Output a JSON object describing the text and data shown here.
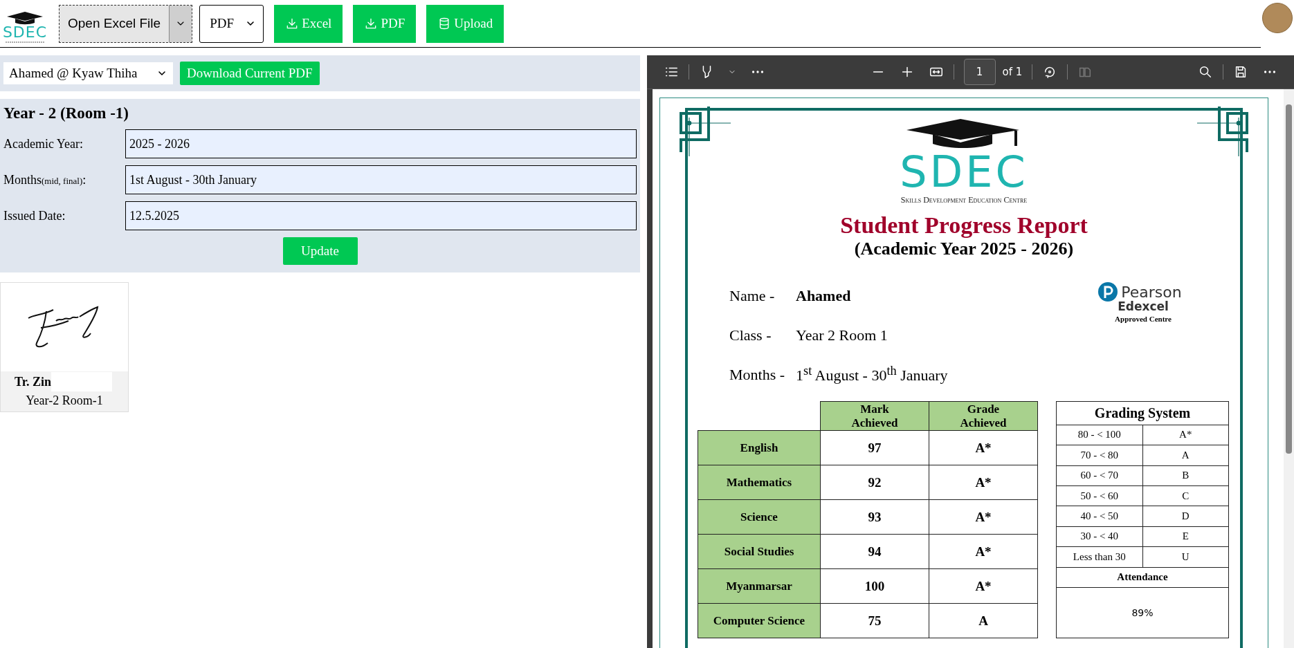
{
  "toolbar": {
    "logo_text": "SDEC",
    "file_button": "Open Excel File",
    "format_select": "PDF",
    "buttons": [
      {
        "label": "Excel",
        "kind": "download"
      },
      {
        "label": "PDF",
        "kind": "download"
      },
      {
        "label": "Upload",
        "kind": "database"
      }
    ]
  },
  "student_bar": {
    "student_select": "Ahamed @ Kyaw Thiha",
    "download_button": "Download Current PDF"
  },
  "class_form": {
    "heading": "Year - 2 (Room -1)",
    "fields": [
      {
        "label": "Academic Year:",
        "value": "2025 - 2026"
      },
      {
        "label": "Months$_{(mid, final)}$:",
        "value": "1st August - 30th January"
      },
      {
        "label": "Issued Date:",
        "value": "12.5.2025"
      }
    ],
    "update_button": "Update"
  },
  "signature_card": {
    "name": "Tr. Zin",
    "class": "Year-2 Room-1"
  },
  "pdf_viewer": {
    "page_input": "1",
    "page_count": "of 1",
    "page_view_button": {
      "disabled": true
    },
    "document": {
      "logo_text": "SDEC",
      "logo_tagline": "Skills Development Education Centre",
      "title": "Student Progress Report",
      "subtitle": "(Academic Year 2025 - 2026)",
      "info": [
        {
          "label": "Name -",
          "value": "Ahamed",
          "kind": "bold"
        },
        {
          "label": "Class -",
          "value": "Year 2 Room 1",
          "kind": "plain"
        },
        {
          "label": "Months -",
          "value": "1$^{st}$ August - 30$^{th}$ January",
          "kind": "plain"
        }
      ],
      "partner": {
        "name": "Pearson",
        "brand": "Edexcel",
        "note": "Approved Centre"
      },
      "marks_table": {
        "columns": [
          "Mark Achieved",
          "Grade Achieved"
        ],
        "rows": [
          {
            "subject": "English",
            "mark": "97",
            "grade": "A*"
          },
          {
            "subject": "Mathematics",
            "mark": "92",
            "grade": "A*"
          },
          {
            "subject": "Science",
            "mark": "93",
            "grade": "A*"
          },
          {
            "subject": "Social Studies",
            "mark": "94",
            "grade": "A*"
          },
          {
            "subject": "Myanmarsar",
            "mark": "100",
            "grade": "A*"
          },
          {
            "subject": "Computer Science",
            "mark": "75",
            "grade": "A"
          }
        ]
      },
      "grading_system": {
        "title": "Grading System",
        "rows": [
          {
            "range": "80 - < 100",
            "grade": "A*"
          },
          {
            "range": "70 - < 80",
            "grade": "A"
          },
          {
            "range": "60 - < 70",
            "grade": "B"
          },
          {
            "range": "50 - < 60",
            "grade": "C"
          },
          {
            "range": "40 - < 50",
            "grade": "D"
          },
          {
            "range": "30 - < 40",
            "grade": "E"
          },
          {
            "range": "Less than 30",
            "grade": "U"
          }
        ],
        "attendance_label": "Attendance",
        "attendance_value": "89%"
      }
    }
  }
}
